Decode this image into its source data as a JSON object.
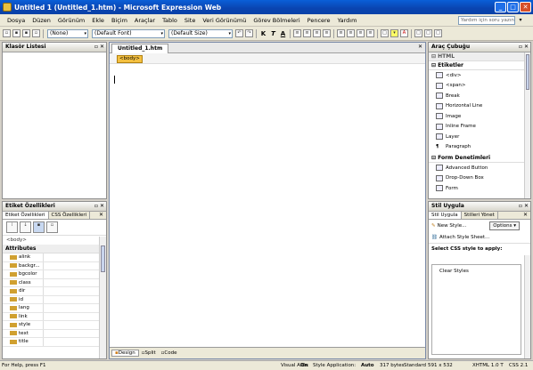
{
  "window": {
    "title": "Untitled 1 (Untitled_1.htm) - Microsoft Expression Web",
    "minimize": "_",
    "maximize": "□",
    "close": "✕"
  },
  "menu": {
    "items": [
      "Dosya",
      "Düzen",
      "Görünüm",
      "Ekle",
      "Biçim",
      "Araçlar",
      "Tablo",
      "Site",
      "Veri Görünümü",
      "Görev Bölmeleri",
      "Pencere",
      "Yardım"
    ],
    "help_placeholder": "Yardım için soru yazın"
  },
  "toolbar": {
    "style_value": "(None)",
    "font_value": "(Default Font)",
    "size_value": "(Default Size)",
    "bold": "K",
    "italic": "T",
    "underline": "A"
  },
  "folder_panel": {
    "title": "Klasör Listesi"
  },
  "tag_props_panel": {
    "title": "Etiket Özellikleri",
    "tabs": [
      "Etiket Özellikleri",
      "CSS Özellikleri"
    ],
    "tag": "<body>",
    "section": "Attributes",
    "attributes": [
      "alink",
      "backgr...",
      "bgcolor",
      "class",
      "dir",
      "id",
      "lang",
      "link",
      "style",
      "text",
      "title"
    ]
  },
  "editor": {
    "tab": "Untitled_1.htm",
    "tag": "<body>",
    "view_tabs": [
      "Design",
      "Split",
      "Code"
    ]
  },
  "toolbox": {
    "title": "Araç Çubuğu",
    "html_section": "HTML",
    "tags_section": "Etiketler",
    "tags": [
      "<div>",
      "<span>",
      "Break",
      "Horizontal Line",
      "Image",
      "Inline Frame",
      "Layer",
      "Paragraph"
    ],
    "form_section": "Form Denetimleri",
    "forms": [
      "Advanced Button",
      "Drop-Down Box",
      "Form"
    ]
  },
  "style_panel": {
    "title": "Stil Uygula",
    "tabs": [
      "Stil Uygula",
      "Stilleri Yönet"
    ],
    "new_style": "New Style...",
    "options": "Options ▾",
    "attach": "Attach Style Sheet...",
    "select_label": "Select CSS style to apply:",
    "clear": "Clear Styles"
  },
  "status": {
    "help": "For Help, press F1",
    "visual_aids_label": "Visual Aids:",
    "visual_aids_value": "On",
    "style_app_label": "Style Application:",
    "style_app_value": "Auto",
    "size": "317 bytes",
    "mode": "Standard",
    "dims": "591 x 532",
    "doctype": "XHTML 1.0 T",
    "css": "CSS 2.1"
  }
}
